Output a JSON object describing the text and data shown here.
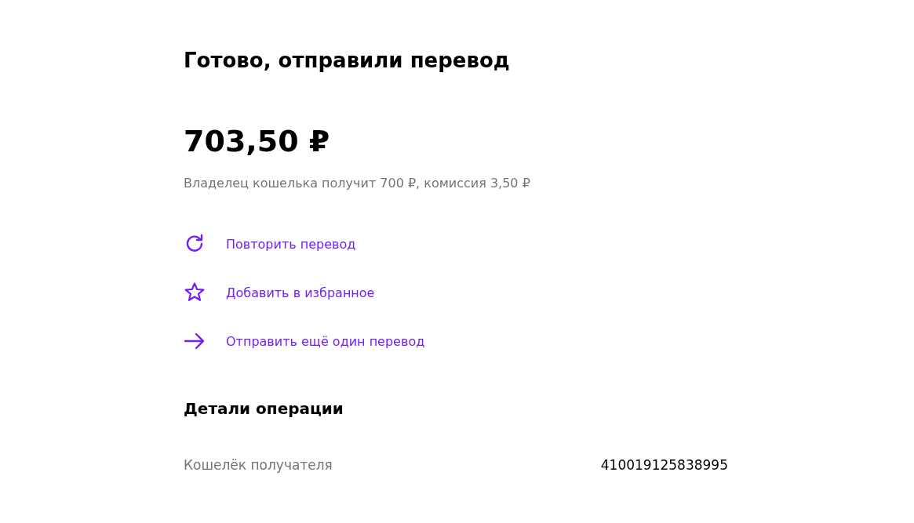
{
  "title": "Готово, отправили перевод",
  "amount": "703,50 ₽",
  "note": "Владелец кошелька получит 700 ₽, комиссия 3,50 ₽",
  "actions": [
    {
      "kind": "repeat",
      "label": "Повторить перевод"
    },
    {
      "kind": "favorite",
      "label": "Добавить в избранное"
    },
    {
      "kind": "send",
      "label": "Отправить ещё один перевод"
    }
  ],
  "details": {
    "heading": "Детали операции",
    "rows": [
      {
        "label": "Кошелёк получателя",
        "value": "410019125838995"
      }
    ]
  }
}
